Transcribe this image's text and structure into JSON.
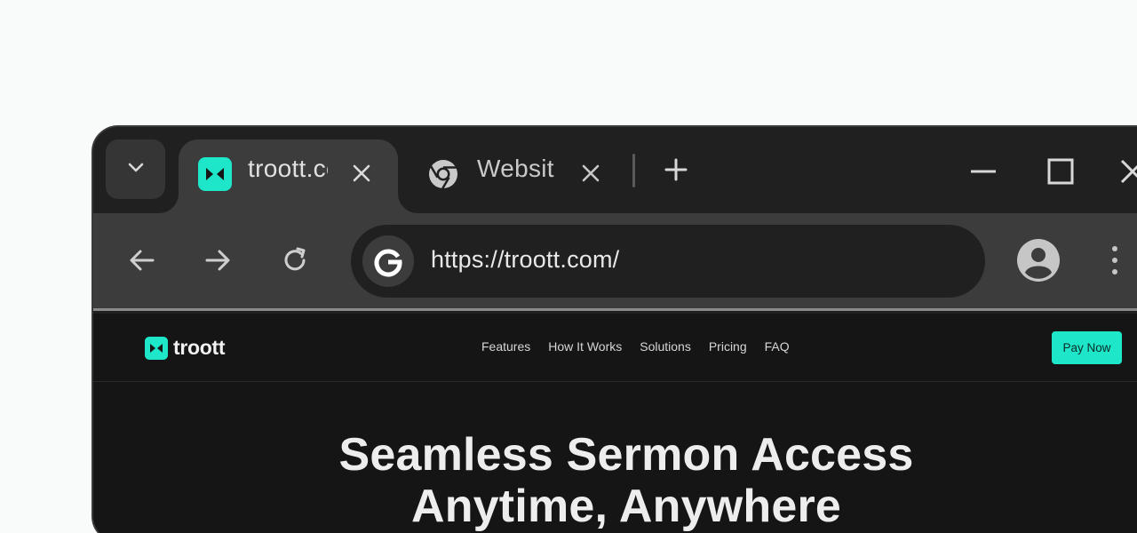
{
  "tabs": [
    {
      "title": "troott.com",
      "favicon": "troott-logo-icon",
      "active": true
    },
    {
      "title": "Website",
      "favicon": "chrome-icon",
      "active": false
    }
  ],
  "toolbar": {
    "url": "https://troott.com/",
    "search_engine_icon": "google-icon"
  },
  "site": {
    "logo_text": "troott",
    "nav": [
      "Features",
      "How It Works",
      "Solutions",
      "Pricing",
      "FAQ"
    ],
    "cta": "Pay Now",
    "hero_line1": "Seamless Sermon Access",
    "hero_line2": "Anytime, Anywhere"
  },
  "colors": {
    "accent": "#1de6c9",
    "chrome_dark": "#202020",
    "chrome_mid": "#3c3c3c",
    "page_bg": "#151515"
  }
}
